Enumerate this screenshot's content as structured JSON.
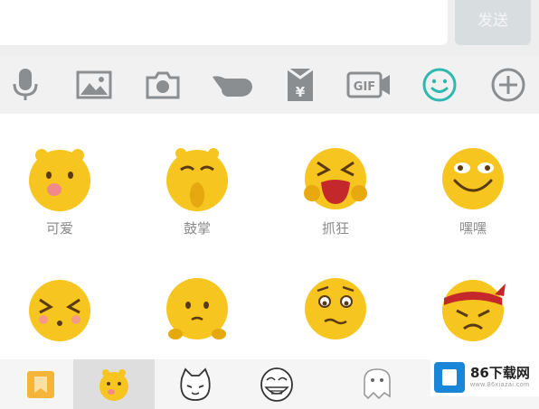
{
  "input": {
    "send_label": "发送"
  },
  "toolbar": {
    "items": [
      {
        "icon": "microphone-icon"
      },
      {
        "icon": "image-icon"
      },
      {
        "icon": "camera-icon"
      },
      {
        "icon": "poke-hand-icon"
      },
      {
        "icon": "red-packet-icon",
        "symbol": "¥"
      },
      {
        "icon": "gif-icon",
        "text": "GIF"
      },
      {
        "icon": "smiley-icon",
        "active": true
      },
      {
        "icon": "plus-icon"
      }
    ],
    "accent": "#2fb8b0"
  },
  "emoji_panel": {
    "rows": [
      [
        {
          "name": "cute-emoji",
          "label": "可爱"
        },
        {
          "name": "applause-emoji",
          "label": "鼓掌"
        },
        {
          "name": "crazy-emoji",
          "label": "抓狂"
        },
        {
          "name": "hehe-emoji",
          "label": "嘿嘿"
        }
      ],
      [
        {
          "name": "squint-emoji",
          "label": ""
        },
        {
          "name": "sad-emoji",
          "label": ""
        },
        {
          "name": "worried-emoji",
          "label": ""
        },
        {
          "name": "angry-headband-emoji",
          "label": ""
        }
      ]
    ],
    "face_color": "#f7c520"
  },
  "tabbar": {
    "tabs": [
      {
        "icon": "favorites-icon"
      },
      {
        "icon": "yellow-face-icon",
        "active": true
      },
      {
        "icon": "cat-sticker-icon"
      },
      {
        "icon": "troll-face-icon"
      },
      {
        "icon": "ghost-sticker-icon"
      }
    ]
  },
  "watermark": {
    "title": "86下载网",
    "subtitle": "www.86xiazai.com"
  }
}
